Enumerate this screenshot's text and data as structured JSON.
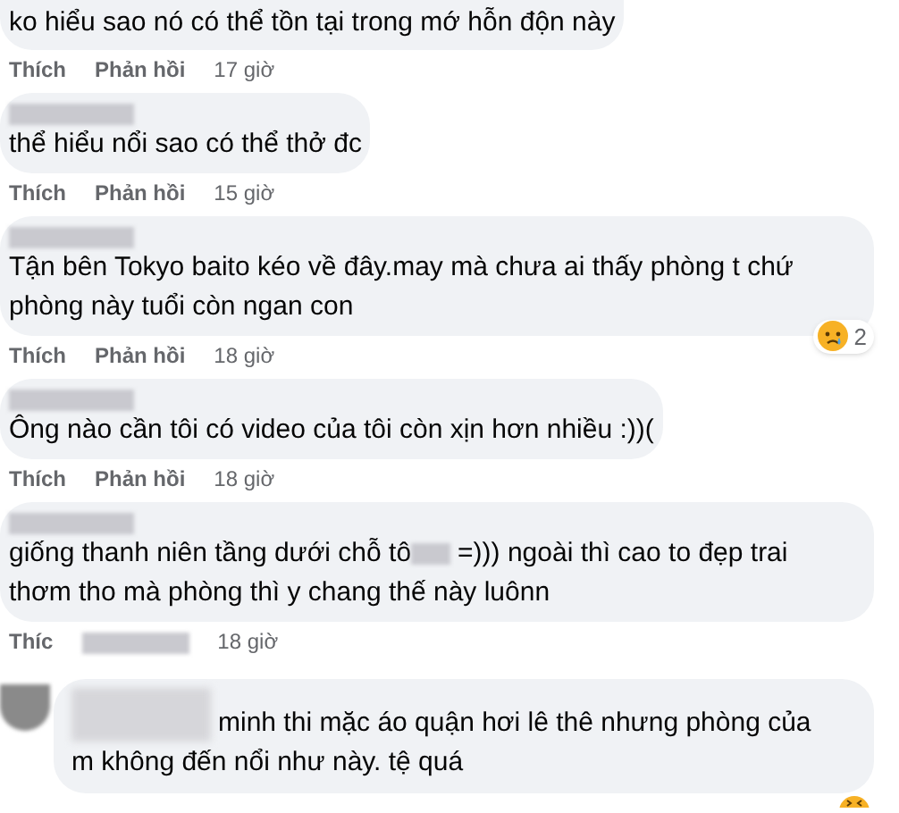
{
  "comments": [
    {
      "kind": "comment",
      "clipped": true,
      "lines": [
        [
          "ko hiểu sao nó có thể tồn tại trong mớ hỗn độn này"
        ]
      ],
      "like": "Thích",
      "reply": "Phản hồi",
      "time": "17 giờ"
    },
    {
      "kind": "comment",
      "clipped": false,
      "name_blurred": true,
      "lines": [
        [
          "thể hiểu nổi sao có thể thở đc"
        ]
      ],
      "like": "Thích",
      "reply": "Phản hồi",
      "time": "15 giờ"
    },
    {
      "kind": "comment",
      "clipped": false,
      "name_blurred": true,
      "lines": [
        [
          "Tận bên Tokyo baito kéo về đây.may mà chưa ai thấy phòng t chứ"
        ],
        [
          "phòng này tuổi còn ngan con"
        ]
      ],
      "like": "Thích",
      "reply": "Phản hồi",
      "time": "18 giờ",
      "reaction": {
        "kind": "sad",
        "count": "2"
      }
    },
    {
      "kind": "comment",
      "clipped": false,
      "name_blurred": true,
      "lines": [
        [
          "Ông nào cần tôi có video của tôi còn xịn hơn nhiều :))("
        ]
      ],
      "like": "Thích",
      "reply": "Phản hồi",
      "time": "18 giờ"
    },
    {
      "kind": "comment",
      "clipped": false,
      "name_blurred": true,
      "lines": [
        [
          "giống thanh niên tầng dưới chỗ tô",
          "=))) ngoài thì cao to đẹp trai"
        ],
        [
          "thơm tho mà phòng thì y chang thế này luônn"
        ]
      ],
      "like": "Thíc",
      "time": "18 giờ",
      "reply_hidden": true
    },
    {
      "kind": "reply",
      "clipped": false,
      "name_blurred": true,
      "lines": [
        [
          "minh thi mặc áo quận hơi lê thê nhưng phòng của"
        ],
        [
          "m không đến nổi như này. tệ quá"
        ]
      ],
      "reaction": {
        "kind": "haha"
      }
    }
  ]
}
